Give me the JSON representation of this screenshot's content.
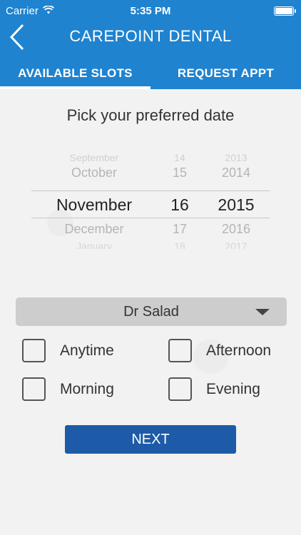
{
  "status_bar": {
    "carrier": "Carrier",
    "time": "5:35 PM"
  },
  "nav": {
    "title": "CAREPOINT DENTAL"
  },
  "tabs": [
    {
      "label": "AVAILABLE SLOTS",
      "active": true
    },
    {
      "label": "REQUEST APPT",
      "active": false
    }
  ],
  "prompt": "Pick your preferred date",
  "date_picker": {
    "rows": [
      {
        "month": "September",
        "day": "14",
        "year": "2013"
      },
      {
        "month": "October",
        "day": "15",
        "year": "2014"
      },
      {
        "month": "November",
        "day": "16",
        "year": "2015"
      },
      {
        "month": "December",
        "day": "17",
        "year": "2016"
      },
      {
        "month": "January",
        "day": "18",
        "year": "2017"
      }
    ],
    "selected_index": 2
  },
  "doctor_select": {
    "value": "Dr Salad"
  },
  "time_options": [
    {
      "label": "Anytime",
      "checked": false
    },
    {
      "label": "Afternoon",
      "checked": false
    },
    {
      "label": "Morning",
      "checked": false
    },
    {
      "label": "Evening",
      "checked": false
    }
  ],
  "next_button": "NEXT",
  "colors": {
    "header_blue": "#1f83cf",
    "button_blue": "#1d5aa8",
    "background": "#f2f2f2"
  }
}
